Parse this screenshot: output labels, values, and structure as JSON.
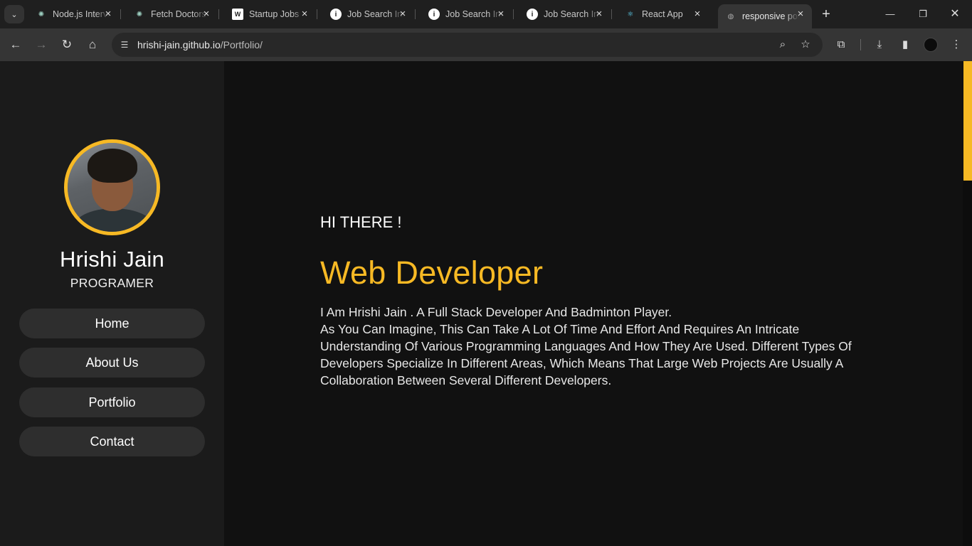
{
  "browser": {
    "tabs": [
      {
        "title": "Node.js Interview",
        "favicon": "openai-icon",
        "color": "#9ccfc0",
        "glyph": "✺"
      },
      {
        "title": "Fetch Doctors",
        "favicon": "openai-icon",
        "color": "#9ccfc0",
        "glyph": "✺"
      },
      {
        "title": "Startup Jobs",
        "favicon": "w-icon",
        "color": "#ffffff",
        "glyph": "W"
      },
      {
        "title": "Job Search Info",
        "favicon": "info-icon",
        "color": "#ffffff",
        "glyph": "i"
      },
      {
        "title": "Job Search Info",
        "favicon": "info-icon",
        "color": "#ffffff",
        "glyph": "i"
      },
      {
        "title": "Job Search Info",
        "favicon": "info-icon",
        "color": "#ffffff",
        "glyph": "i"
      },
      {
        "title": "React App",
        "favicon": "react-icon",
        "color": "#61dafb",
        "glyph": "⚛"
      },
      {
        "title": "responsive portfolio",
        "favicon": "globe-icon",
        "color": "#aaaaaa",
        "glyph": "◍"
      }
    ],
    "active_tab": 7,
    "url": {
      "host": "hrishi-jain.github.io",
      "path": "/Portfolio/"
    }
  },
  "sidebar": {
    "name": "Hrishi Jain",
    "role": "PROGRAMER",
    "menu": [
      "Home",
      "About Us",
      "Portfolio",
      "Contact"
    ]
  },
  "main": {
    "greeting": "HI THERE !",
    "headline": "Web Developer",
    "bio_line1": "I Am Hrishi Jain . A Full Stack Developer And Badminton Player.",
    "bio_line2": "As You Can Imagine, This Can Take A Lot Of Time And Effort And Requires An Intricate Understanding Of Various Programming Languages And How They Are Used. Different Types Of Developers Specialize In Different Areas, Which Means That Large Web Projects Are Usually A Collaboration Between Several Different Developers."
  },
  "colors": {
    "accent": "#f7b924",
    "sidebar_bg": "#1b1b1b",
    "page_bg": "#111111",
    "button_bg": "#2e2e2e"
  }
}
